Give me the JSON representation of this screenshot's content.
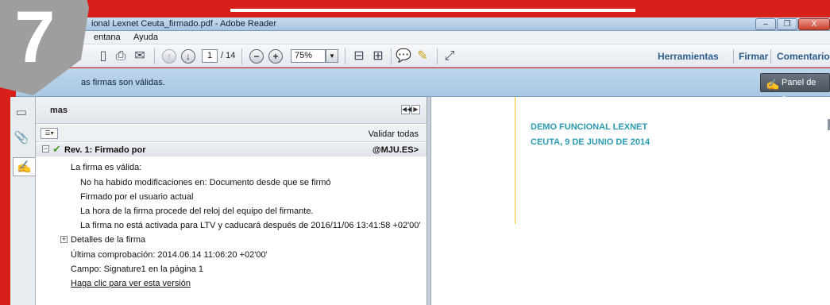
{
  "window": {
    "title": "ional Lexnet Ceuta_firmado.pdf - Adobe Reader",
    "buttons": [
      "–",
      "❐",
      "X"
    ]
  },
  "badge": {
    "number": "7"
  },
  "menubar": {
    "items": [
      "entana",
      "Ayuda"
    ]
  },
  "toolbar": {
    "page_current": "1",
    "page_total": "/ 14",
    "zoom": "75%",
    "right": {
      "tools": "Herramientas",
      "sign": "Firmar",
      "comment": "Comentario"
    }
  },
  "sigbar": {
    "message": "as firmas son válidas.",
    "panel_button": "Panel de firma"
  },
  "sigpanel": {
    "header": "mas",
    "validate_all": "Validar todas",
    "revision": {
      "label": "Rev. 1: Firmado por",
      "email": "@MJU.ES>"
    },
    "lines": [
      "La firma es válida:",
      "No ha habido modificaciones en: Documento desde que se firmó",
      "Firmado por el usuario actual",
      "La hora de la firma procede del reloj del equipo del firmante.",
      "La firma no está activada para LTV y caducará después de 2016/11/06 13:41:58 +02'00'",
      "Detalles de la firma",
      "Última comprobación: 2014.06.14 11:06:20 +02'00'",
      "Campo: Signature1 en la página 1",
      "Haga clic para ver esta versión"
    ]
  },
  "document": {
    "title": "DEMO FUNCIONAL LEXNET",
    "subtitle": "CEUTA, 9 DE JUNIO DE 2014"
  },
  "colors": {
    "frame_red": "#d8201a",
    "accent_teal": "#2b9ab0",
    "valid_green": "#4a9d2f"
  }
}
